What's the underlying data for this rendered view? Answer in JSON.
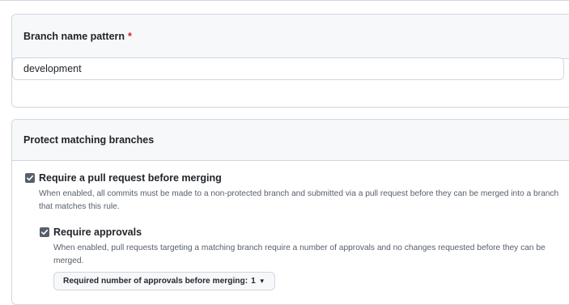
{
  "branch_section": {
    "header_label": "Branch name pattern",
    "required_marker": "*",
    "pattern_value": "development"
  },
  "protect_section": {
    "header_label": "Protect matching branches",
    "require_pr": {
      "checked": true,
      "title": "Require a pull request before merging",
      "description": "When enabled, all commits must be made to a non-protected branch and submitted via a pull request before they can be merged into a branch that matches this rule."
    },
    "require_approvals": {
      "checked": true,
      "title": "Require approvals",
      "description": "When enabled, pull requests targeting a matching branch require a number of approvals and no changes requested before they can be merged.",
      "select_label": "Required number of approvals before merging:",
      "select_value": "1"
    }
  },
  "colors": {
    "required": "#cf222e",
    "checkbox": "#57606a",
    "header_bg": "#f6f8fa",
    "border": "#d0d7de"
  }
}
